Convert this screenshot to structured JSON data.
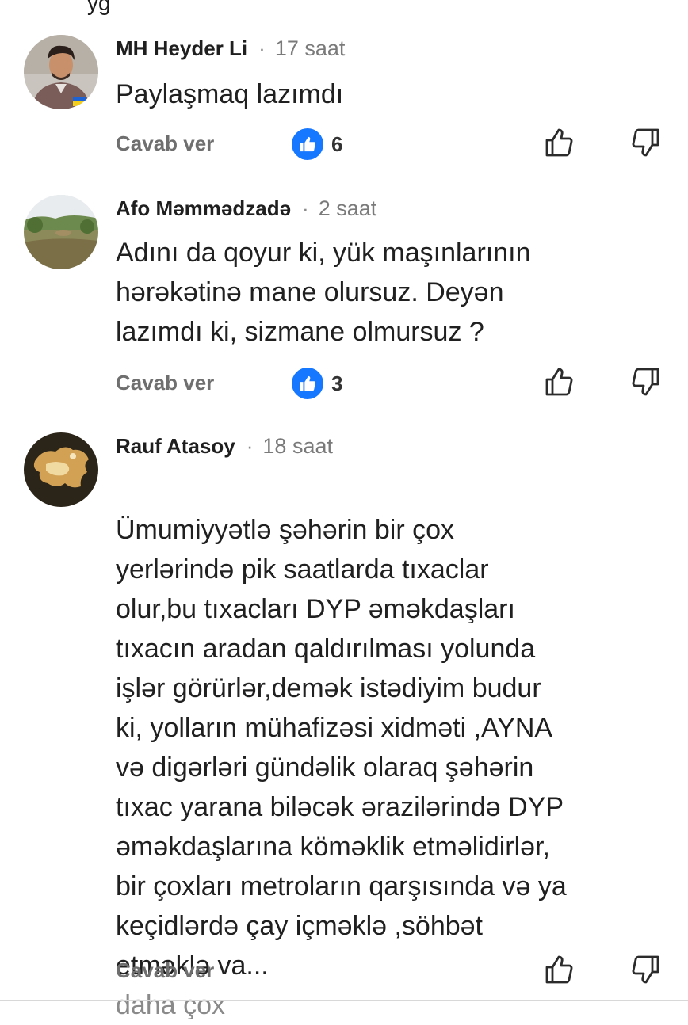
{
  "colors": {
    "accent": "#1677ff",
    "meta": "#7a7a7a",
    "text": "#202020"
  },
  "comments": [
    {
      "author": "MH Heyder Li",
      "separator": "·",
      "time": "17 saat",
      "text": "Paylaşmaq lazımdı",
      "reply_label": "Cavab ver",
      "like_count": "6",
      "avatar": "user-photo-avatar"
    },
    {
      "author": "Afo Məmmədzadə",
      "separator": "·",
      "time": "2 saat",
      "text": "Adını da qoyur ki, yük maşınlarının\nhərəkətinə mane olursuz. Deyən\nlazımdı ki, sizmane olmursuz ?",
      "reply_label": "Cavab ver",
      "like_count": "3",
      "avatar": "landscape-avatar"
    },
    {
      "author": "Rauf Atasoy",
      "separator": "·",
      "time": "18 saat",
      "text": "Ümumiyyətlə şəhərin bir çox\nyerlərində pik saatlarda tıxaclar\nolur,bu tıxacları DYP əməkdaşları\ntıxacın aradan qaldırılması yolunda\nişlər görürlər,demək istədiyim budur\nki, yolların mühafizəsi xidməti ,AYNA\nvə digərləri gündəlik olaraq şəhərin\ntıxac yarana biləcək ərazilərində DYP\nəməkdaşlarına köməklik etməlidirlər,\nbir çoxları metroların qarşısında və ya\nkeçidlərdə çay içməklə ,söhbət\netməklə va...",
      "more_label": "daha çox",
      "reply_label": "Cavab ver",
      "avatar": "map-avatar"
    }
  ]
}
